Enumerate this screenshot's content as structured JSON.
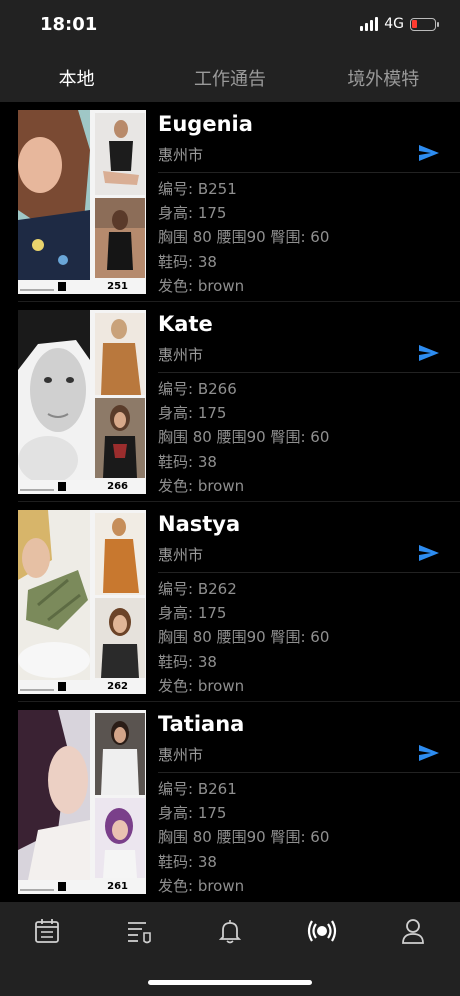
{
  "status": {
    "time": "18:01",
    "network": "4G"
  },
  "tabs": [
    {
      "label": "本地",
      "active": true
    },
    {
      "label": "工作通告",
      "active": false
    },
    {
      "label": "境外模特",
      "active": false
    }
  ],
  "models": [
    {
      "name": "Eugenia",
      "city": "惠州市",
      "code_line": "编号: B251",
      "height_line": "身高: 175",
      "measure_line": "胸围 80 腰围90 臀围: 60",
      "shoe_line": "鞋码: 38",
      "hair_line": "发色: brown",
      "photo_code": "251"
    },
    {
      "name": "Kate",
      "city": "惠州市",
      "code_line": "编号: B266",
      "height_line": "身高: 175",
      "measure_line": "胸围 80 腰围90 臀围: 60",
      "shoe_line": "鞋码: 38",
      "hair_line": "发色: brown",
      "photo_code": "266"
    },
    {
      "name": "Nastya",
      "city": "惠州市",
      "code_line": "编号: B262",
      "height_line": "身高: 175",
      "measure_line": "胸围 80 腰围90 臀围: 60",
      "shoe_line": "鞋码: 38",
      "hair_line": "发色: brown",
      "photo_code": "262"
    },
    {
      "name": "Tatiana",
      "city": "惠州市",
      "code_line": "编号: B261",
      "height_line": "身高: 175",
      "measure_line": "胸围 80 腰围90 臀围: 60",
      "shoe_line": "鞋码: 38",
      "hair_line": "发色: brown",
      "photo_code": "261"
    }
  ],
  "bottom_nav": [
    {
      "icon": "calendar-list-icon"
    },
    {
      "icon": "notice-list-icon"
    },
    {
      "icon": "bell-icon"
    },
    {
      "icon": "broadcast-icon"
    },
    {
      "icon": "user-icon"
    }
  ],
  "colors": {
    "accent": "#2d8cf0",
    "bar_bg": "#222222",
    "page_bg": "#000000"
  }
}
